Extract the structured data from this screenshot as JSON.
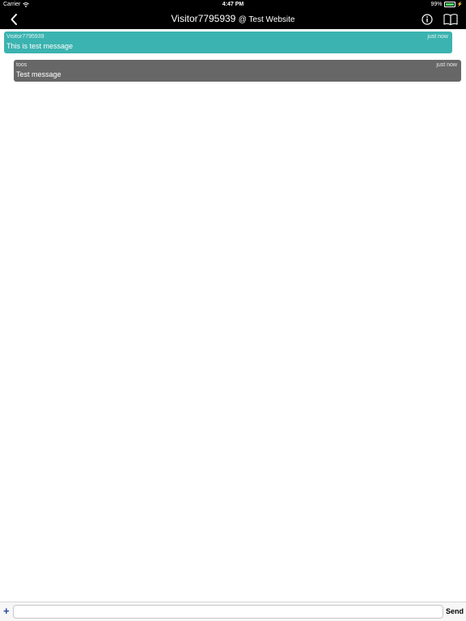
{
  "status_bar": {
    "carrier": "Carrier",
    "time": "4:47 PM",
    "battery": "99%",
    "battery_level": 0.99
  },
  "nav": {
    "visitor": "Visitor7795939",
    "site": "@ Test Website"
  },
  "messages": [
    {
      "sender": "Visitor7795939",
      "time": "just now",
      "text": "This is test message"
    },
    {
      "sender": "toos",
      "time": "just now",
      "text": "Test message"
    }
  ],
  "input_bar": {
    "plus_label": "+",
    "placeholder": "",
    "send_label": "Send"
  },
  "colors": {
    "visitor_bubble": "#3bb3b0",
    "agent_bubble": "#676767",
    "bar_background": "#000000"
  }
}
